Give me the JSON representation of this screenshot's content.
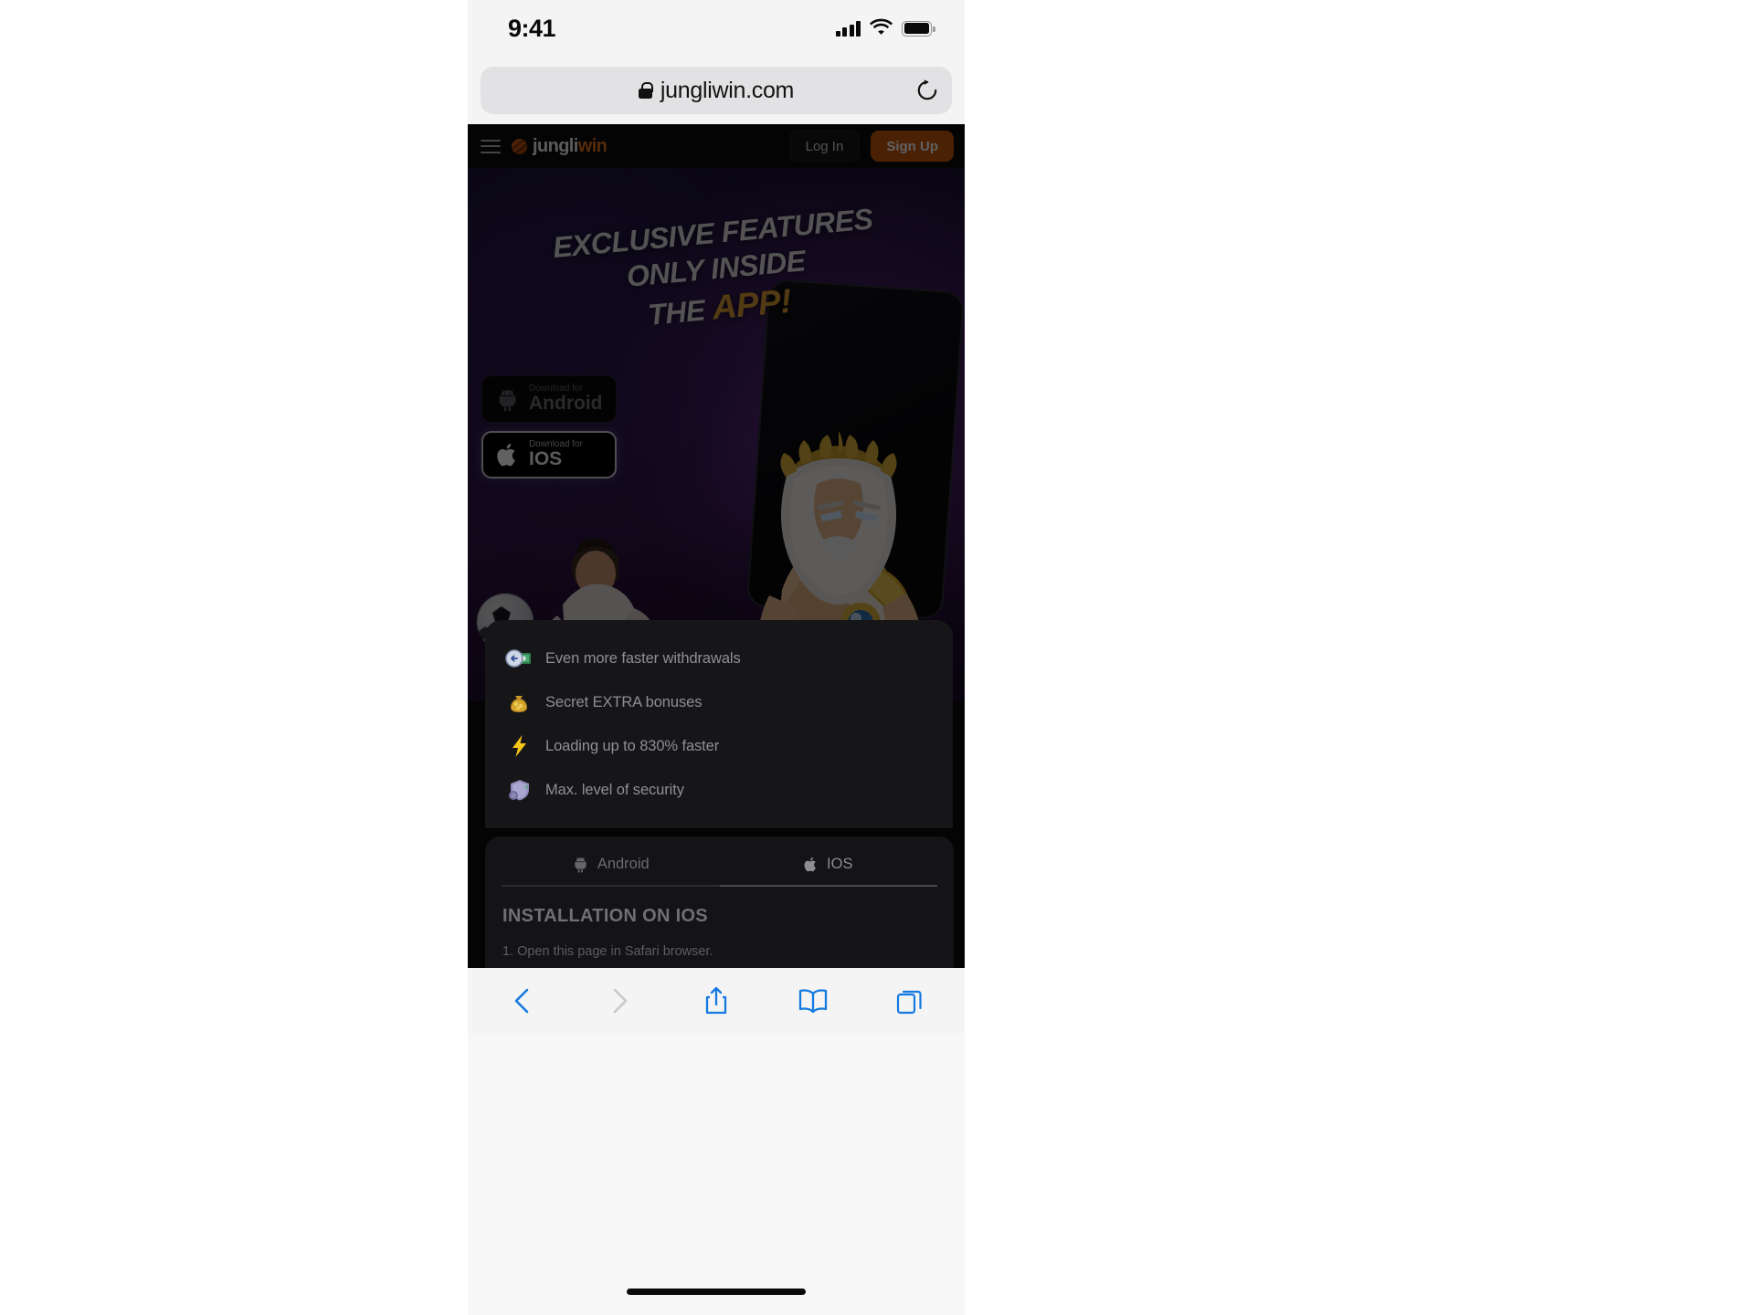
{
  "status_bar": {
    "time": "9:41",
    "signal_icon": "cellular-signal-icon",
    "wifi_icon": "wifi-icon",
    "battery_icon": "battery-icon"
  },
  "browser": {
    "url": "jungliwin.com",
    "lock_icon": "lock-icon",
    "reload_icon": "reload-icon",
    "toolbar": {
      "back_label": "back-icon",
      "forward_label": "forward-icon",
      "share_label": "share-icon",
      "bookmarks_label": "bookmarks-icon",
      "tabs_label": "tabs-icon"
    }
  },
  "site": {
    "header": {
      "menu_icon": "hamburger-menu-icon",
      "brand_first": "jungli",
      "brand_second": "win",
      "login_label": "Log In",
      "signup_label": "Sign Up"
    },
    "hero": {
      "line1": "EXCLUSIVE FEATURES",
      "line2": "ONLY INSIDE",
      "line3_prefix": "THE ",
      "line3_accent": "APP!",
      "download_buttons": [
        {
          "small": "Download for",
          "big": "Android",
          "icon": "android-icon",
          "state": "inactive"
        },
        {
          "small": "Download for",
          "big": "IOS",
          "icon": "apple-icon",
          "state": "active"
        }
      ]
    },
    "features": [
      {
        "icon": "money-withdrawal-icon",
        "label": "Even more faster withdrawals"
      },
      {
        "icon": "money-bag-icon",
        "label": "Secret EXTRA bonuses"
      },
      {
        "icon": "lightning-bolt-icon",
        "label": "Loading up to 830% faster"
      },
      {
        "icon": "shield-security-icon",
        "label": "Max. level of security"
      }
    ],
    "install": {
      "tabs": [
        {
          "label": "Android",
          "icon": "android-icon",
          "active": false
        },
        {
          "label": "IOS",
          "icon": "apple-icon",
          "active": true
        }
      ],
      "title": "INSTALLATION ON IOS",
      "step1": "1. Open this page in Safari browser."
    }
  },
  "colors": {
    "brand_orange": "#e2751d",
    "signup_bg": "#c4570e",
    "accent_gold": "#d89b32",
    "safari_blue": "#1479e0",
    "sheet_bg": "#161618"
  }
}
